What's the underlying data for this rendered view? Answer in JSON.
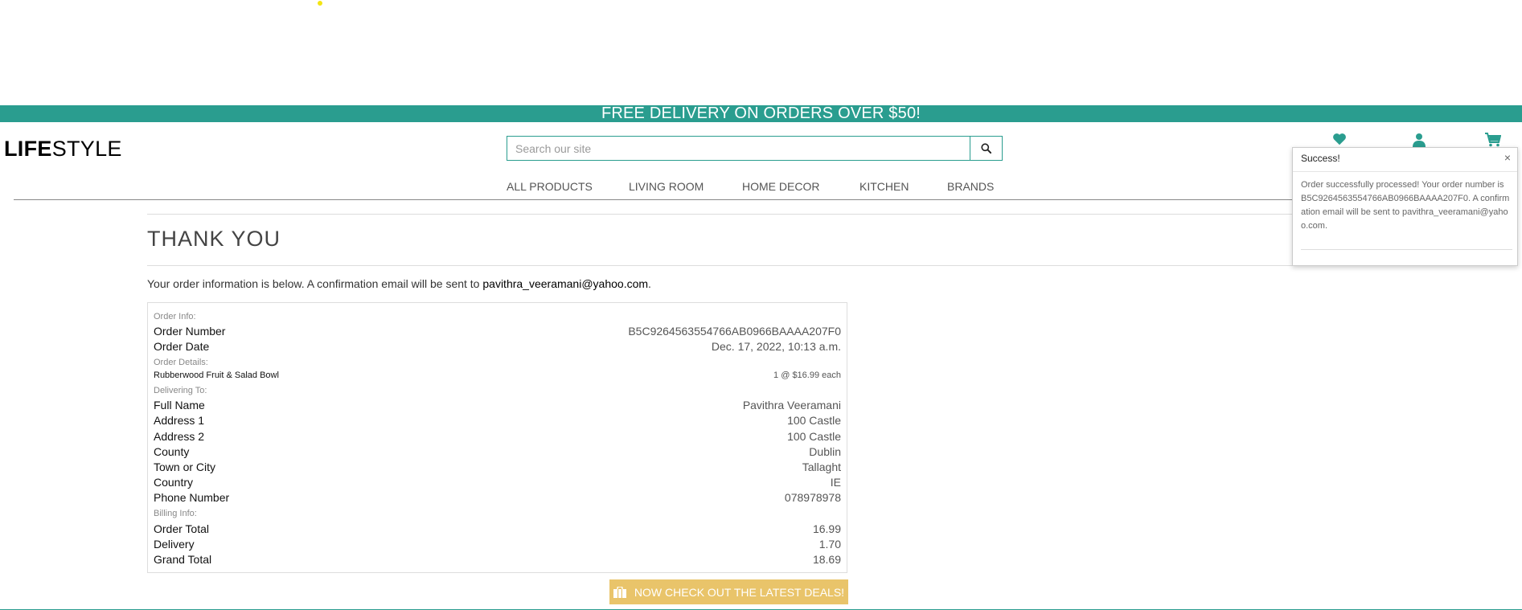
{
  "banner": {
    "text": "FREE DELIVERY ON ORDERS OVER $50!"
  },
  "header": {
    "logo_bold": "LIFE",
    "logo_light": "STYLE",
    "search_placeholder": "Search our site",
    "icons": [
      "heart-icon",
      "user-icon",
      "cart-icon"
    ]
  },
  "nav": {
    "items": [
      "ALL PRODUCTS",
      "LIVING ROOM",
      "HOME DECOR",
      "KITCHEN",
      "BRANDS"
    ]
  },
  "main": {
    "title": "THANK YOU",
    "intro_text": "Your order information is below. A confirmation email will be sent to ",
    "intro_email": "pavithra_veeramani@yahoo.com",
    "intro_end": "."
  },
  "order": {
    "order_info_label": "Order Info:",
    "order_number_label": "Order Number",
    "order_number": "B5C9264563554766AB0966BAAAA207F0",
    "order_date_label": "Order Date",
    "order_date": "Dec. 17, 2022, 10:13 a.m.",
    "details_label": "Order Details:",
    "item_name": "Rubberwood Fruit & Salad Bowl",
    "item_qty": "1 @ $16.99 each",
    "delivering_label": "Delivering To:",
    "full_name_label": "Full Name",
    "full_name": "Pavithra Veeramani",
    "address1_label": "Address 1",
    "address1": "100 Castle",
    "address2_label": "Address 2",
    "address2": "100 Castle",
    "county_label": "County",
    "county": "Dublin",
    "town_label": "Town or City",
    "town": "Tallaght",
    "country_label": "Country",
    "country": "IE",
    "phone_label": "Phone Number",
    "phone": "078978978",
    "billing_label": "Billing Info:",
    "order_total_label": "Order Total",
    "order_total": "16.99",
    "delivery_label": "Delivery",
    "delivery": "1.70",
    "grand_total_label": "Grand Total",
    "grand_total": "18.69"
  },
  "deals_button": {
    "label": "NOW CHECK OUT THE LATEST DEALS!"
  },
  "toast": {
    "title": "Success!",
    "close": "×",
    "message": "Order successfully processed! Your order number is B5C9264563554766AB0966BAAAA207F0. A confirmation email will be sent to pavithra_veeramani@yahoo.com."
  },
  "colors": {
    "accent": "#2a9d8f",
    "deals": "#e9c46a"
  }
}
